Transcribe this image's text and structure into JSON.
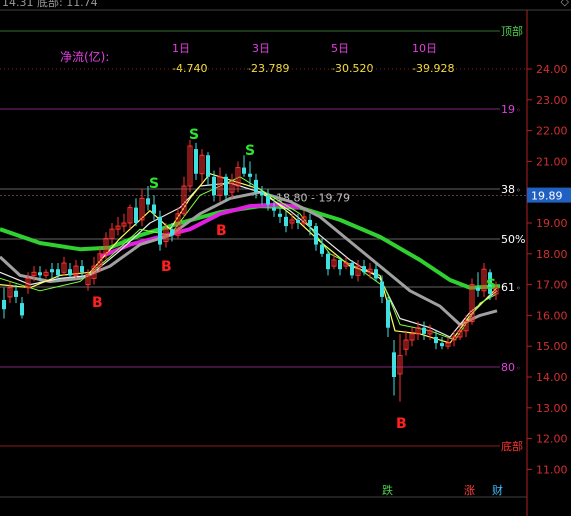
{
  "header": {
    "info_text": "14.31  底部: 11.74",
    "diamond_icon": "diamond-icon"
  },
  "net_flow": {
    "label": "净流(亿):",
    "periods": [
      {
        "label": "1日",
        "value": "-4.740"
      },
      {
        "label": "3日",
        "value": "-23.789"
      },
      {
        "label": "5日",
        "value": "-30.520"
      },
      {
        "label": "10日",
        "value": "-39.928"
      }
    ]
  },
  "levels": [
    {
      "label": "顶部",
      "color": "#4cd04c"
    },
    {
      "label": "19",
      "color": "#e040e0"
    },
    {
      "label": "38",
      "color": "#ffffff"
    },
    {
      "label": "50%",
      "color": "#ffffff"
    },
    {
      "label": "61",
      "color": "#ffffff"
    },
    {
      "label": "80",
      "color": "#e040e0"
    },
    {
      "label": "底部",
      "color": "#ff3030"
    }
  ],
  "price_axis": [
    "24.00",
    "23.00",
    "22.00",
    "21.00",
    "20.00",
    "19.00",
    "18.00",
    "17.00",
    "16.00",
    "15.00",
    "14.00",
    "13.00",
    "12.00",
    "11.00"
  ],
  "current_price": "19.89",
  "range_label": "18.80 - 19.79",
  "signals": {
    "buy": "B",
    "sell": "S"
  },
  "bottom_buttons": [
    {
      "label": "跌",
      "color": "#4cd04c"
    },
    {
      "label": "涨",
      "color": "#ff4040"
    },
    {
      "label": "财",
      "color": "#40c0ff"
    }
  ],
  "colors": {
    "up": "#ff3030",
    "down": "#40e0e0",
    "ma_green": "#30d030",
    "ma_magenta": "#e020e0",
    "ma_gray": "#a0a0a0",
    "ma_yellow": "#ffff60"
  }
}
